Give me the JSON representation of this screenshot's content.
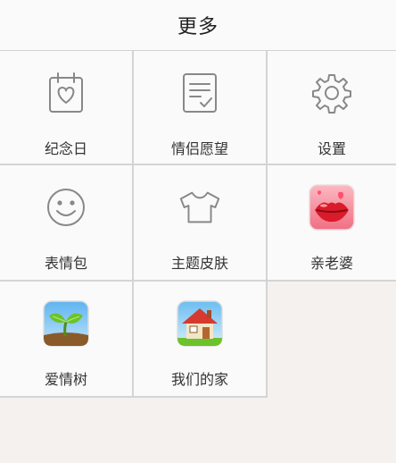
{
  "header": {
    "title": "更多"
  },
  "tiles": [
    {
      "label": "纪念日",
      "icon": "calendar-heart-icon"
    },
    {
      "label": "情侣愿望",
      "icon": "wish-list-icon"
    },
    {
      "label": "设置",
      "icon": "gear-icon"
    },
    {
      "label": "表情包",
      "icon": "smiley-icon"
    },
    {
      "label": "主题皮肤",
      "icon": "tshirt-icon"
    },
    {
      "label": "亲老婆",
      "icon": "kiss-lips-icon"
    },
    {
      "label": "爱情树",
      "icon": "sprout-icon"
    },
    {
      "label": "我们的家",
      "icon": "house-icon"
    }
  ],
  "colors": {
    "line_icon": "#888888",
    "background": "#f4f1ef",
    "tile_background": "#fafafa",
    "divider": "#d4d4d4"
  }
}
